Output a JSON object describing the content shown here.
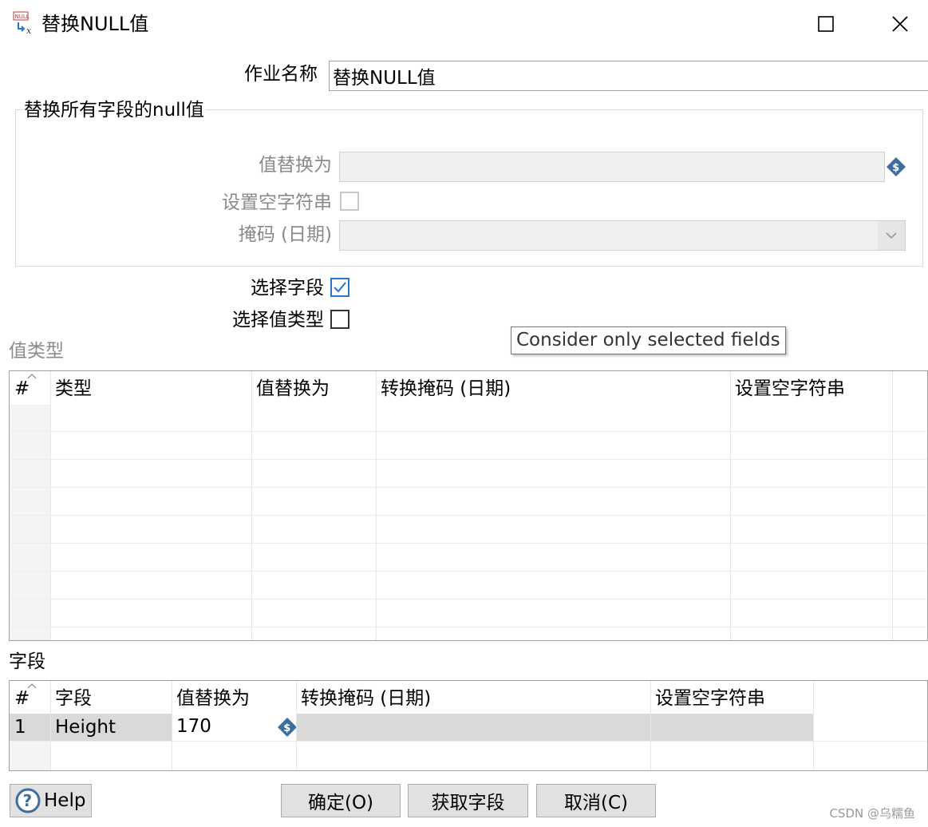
{
  "window": {
    "title": "替换NULL值",
    "icon_text": "NULL",
    "icon_sub": "x"
  },
  "form": {
    "step_name_label": "作业名称",
    "step_name_value": "替换NULL值",
    "group_title": "替换所有字段的null值",
    "replace_with_label": "值替换为",
    "replace_with_value": "",
    "set_empty_label": "设置空字符串",
    "mask_label": "掩码 (日期)",
    "mask_value": "",
    "select_fields_label": "选择字段",
    "select_fields_checked": true,
    "select_value_type_label": "选择值类型",
    "select_value_type_checked": false
  },
  "tooltip": "Consider only selected fields",
  "value_types": {
    "section_label": "值类型",
    "headers": [
      "#",
      "类型",
      "值替换为",
      "转换掩码 (日期)",
      "设置空字符串"
    ],
    "rows": []
  },
  "fields": {
    "section_label": "字段",
    "headers": [
      "#",
      "字段",
      "值替换为",
      "转换掩码 (日期)",
      "设置空字符串"
    ],
    "rows": [
      {
        "num": "1",
        "field": "Height",
        "replace": "170",
        "mask": "",
        "set_empty": ""
      }
    ]
  },
  "buttons": {
    "help": "Help",
    "ok": "确定(O)",
    "get_fields": "获取字段",
    "cancel": "取消(C)"
  },
  "watermark": "CSDN @乌糯鱼",
  "colors": {
    "accent": "#2a76c6",
    "disabled_text": "#8a8a8a",
    "selected_row": "#d9d9d9",
    "button_bg": "#e1e1e1"
  }
}
